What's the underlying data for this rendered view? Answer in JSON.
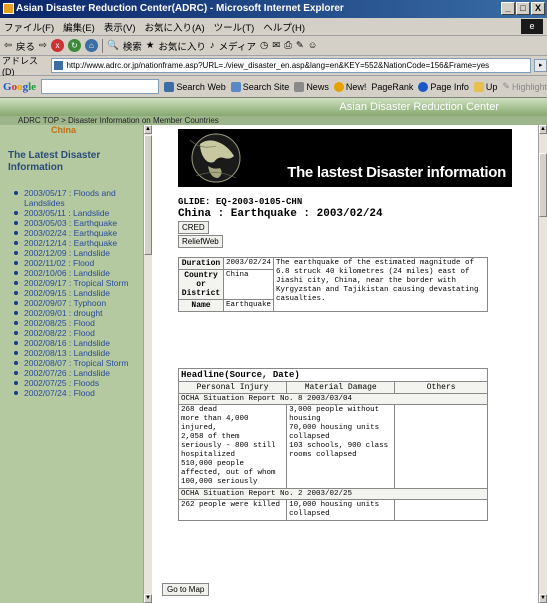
{
  "window": {
    "title": "Asian Disaster Reduction Center(ADRC) - Microsoft Internet Explorer",
    "min": "_",
    "max": "□",
    "close": "X"
  },
  "menu": [
    "ファイル(F)",
    "編集(E)",
    "表示(V)",
    "お気に入り(A)",
    "ツール(T)",
    "ヘルプ(H)"
  ],
  "toolbar": {
    "back": "戻る",
    "search": "検索",
    "favorites": "お気に入り",
    "media": "メディア",
    "ie_logo": "e"
  },
  "address": {
    "label": "アドレス(D)",
    "url": "http://www.adrc.or.jp/nationframe.asp?URL=./view_disaster_en.asp&lang=en&KEY=552&NationCode=156&Frame=yes",
    "go": "▸"
  },
  "googlebar": {
    "logo": [
      "G",
      "o",
      "o",
      "g",
      "le"
    ],
    "search_web": "Search Web",
    "search_site": "Search Site",
    "news": "News",
    "new": "New!",
    "pagerank": "PageRank",
    "page_info": "Page Info",
    "up": "Up",
    "highlight": "Highlight"
  },
  "site": {
    "header": "Asian Disaster Reduction Center",
    "breadcrumb": [
      "ADRC TOP",
      "Disaster Information on Member Countries"
    ],
    "breadcrumb_sep": ">"
  },
  "sidebar": {
    "country": "China",
    "heading": "The Latest Disaster Information",
    "items": [
      "2003/05/17 : Floods and Landslides",
      "2003/05/11 : Landslide",
      "2003/05/03 : Earthquake",
      "2003/02/24 : Earthquake",
      "2002/12/14 : Earthquake",
      "2002/12/09 : Landslide",
      "2002/11/02 : Flood",
      "2002/10/06 : Landslide",
      "2002/09/17 : Tropical Storm",
      "2002/09/15 : Landslide",
      "2002/09/07 : Typhoon",
      "2002/09/01 : drought",
      "2002/08/25 : Flood",
      "2002/08/22 : Flood",
      "2002/08/16 : Landslide",
      "2002/08/13 : Landslide",
      "2002/08/07 : Tropical Storm",
      "2002/07/26 : Landslide",
      "2002/07/25 : Floods",
      "2002/07/24 : Flood"
    ]
  },
  "main": {
    "banner_title": "The lastest Disaster information",
    "glide_label": "GLIDE:",
    "glide_code": "EQ-2003-0105-CHN",
    "event_title": "China : Earthquake : 2003/02/24",
    "buttons": {
      "cred": "CRED",
      "reliefweb": "ReliefWeb",
      "go_to_map": "Go to Map"
    },
    "summary": {
      "duration_label": "Duration",
      "duration_value": "2003/02/24",
      "country_label": "Country or District",
      "country_value": "China",
      "name_label": "Name",
      "name_value": "Earthquake",
      "description": "The earthquake of the estimated magnitude of 6.8 struck 40 kilometres (24 miles) east of Jiashi city, China, near the border with Kyrgyzstan and Tajikistan causing devastating casualties."
    },
    "headline": {
      "title": "Headline(Source, Date)",
      "columns": [
        "Personal Injury",
        "Material Damage",
        "Others"
      ],
      "reports": [
        {
          "source": "OCHA Situation Report No. 8 2003/03/04",
          "injury": "268 dead\nmore than 4,000 injured,\n2,058 of them seriously - 800 still hospitalized\n510,000 people affected, out of whom 100,000 seriously",
          "damage": "3,000 people without housing\n70,000 housing units collapsed\n103 schools, 900 class rooms collapsed",
          "others": ""
        },
        {
          "source": "OCHA Situation Report No. 2 2003/02/25",
          "injury": "262 people were killed",
          "damage": "10,000 housing units collapsed",
          "others": ""
        }
      ]
    }
  }
}
